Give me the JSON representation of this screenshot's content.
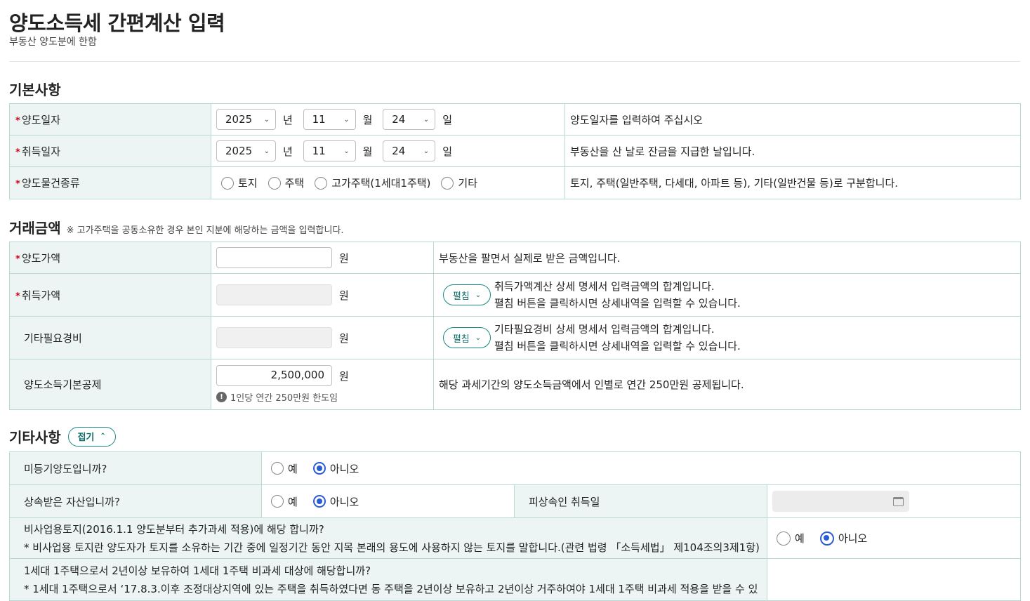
{
  "title": "양도소득세 간편계산 입력",
  "subtitle": "부동산 양도분에 한함",
  "sections": {
    "basic": {
      "title": "기본사항",
      "transfer_date": {
        "label": "양도일자",
        "year": "2025",
        "month": "11",
        "day": "24",
        "desc": "양도일자를 입력하여 주십시오"
      },
      "acquire_date": {
        "label": "취득일자",
        "year": "2025",
        "month": "11",
        "day": "24",
        "desc": "부동산을 산 날로 잔금을 지급한 날입니다."
      },
      "unit_year": "년",
      "unit_month": "월",
      "unit_day": "일",
      "property_type": {
        "label": "양도물건종류",
        "options": [
          "토지",
          "주택",
          "고가주택(1세대1주택)",
          "기타"
        ],
        "desc": "토지, 주택(일반주택, 다세대, 아파트 등), 기타(일반건물 등)로 구분합니다."
      }
    },
    "amount": {
      "title": "거래금액",
      "note": "※ 고가주택을 공동소유한 경우 본인 지분에 해당하는 금액을 입력합니다.",
      "won": "원",
      "sale_price": {
        "label": "양도가액",
        "value": "",
        "desc": "부동산을 팔면서 실제로 받은 금액입니다."
      },
      "acq_price": {
        "label": "취득가액",
        "value": "",
        "button": "펼침",
        "desc1": "취득가액계산 상세 명세서 입력금액의 합계입니다.",
        "desc2": "펼침 버튼을 클릭하시면 상세내역을 입력할 수 있습니다."
      },
      "other_cost": {
        "label": "기타필요경비",
        "value": "",
        "button": "펼침",
        "desc1": "기타필요경비 상세 명세서 입력금액의 합계입니다.",
        "desc2": "펼침 버튼을 클릭하시면 상세내역을 입력할 수 있습니다."
      },
      "basic_deduction": {
        "label": "양도소득기본공제",
        "value": "2,500,000",
        "hint": "1인당 연간 250만원 한도임",
        "desc": "해당 과세기간의 양도소득금액에서 인별로 연간 250만원 공제됩니다."
      }
    },
    "etc": {
      "title": "기타사항",
      "fold_button": "접기",
      "yes": "예",
      "no": "아니오",
      "unregistered": {
        "label": "미등기양도입니까?",
        "selected": "아니오"
      },
      "inherited": {
        "label": "상속받은 자산입니까?",
        "selected": "아니오",
        "decedent_label": "피상속인 취득일"
      },
      "non_business": {
        "label": "비사업용토지(2016.1.1 양도분부터 추가과세 적용)에 해당 합니까?",
        "note": "* 비사업용 토지란 양도자가 토지를 소유하는 기간 중에 일정기간 동안 지목 본래의 용도에 사용하지 않는 토지를 말합니다.(관련 법령 「소득세법」 제104조의3제1항)",
        "selected": "아니오"
      },
      "one_house": {
        "label": "1세대 1주택으로서 2년이상 보유하여 1세대 1주택 비과세 대상에 해당합니까?",
        "note": "* 1세대 1주택으로서 ‘17.8.3.이후 조정대상지역에 있는 주택을 취득하였다면 동 주택을 2년이상 보유하고 2년이상 거주하여야 1세대 1주택 비과세 적용을 받을 수 있"
      }
    }
  },
  "colors": {
    "border": "#b8d8d4",
    "header_bg": "#ecf5f4",
    "accent": "#1a8a84",
    "radio": "#2a5bd7",
    "required": "#d0021b"
  }
}
